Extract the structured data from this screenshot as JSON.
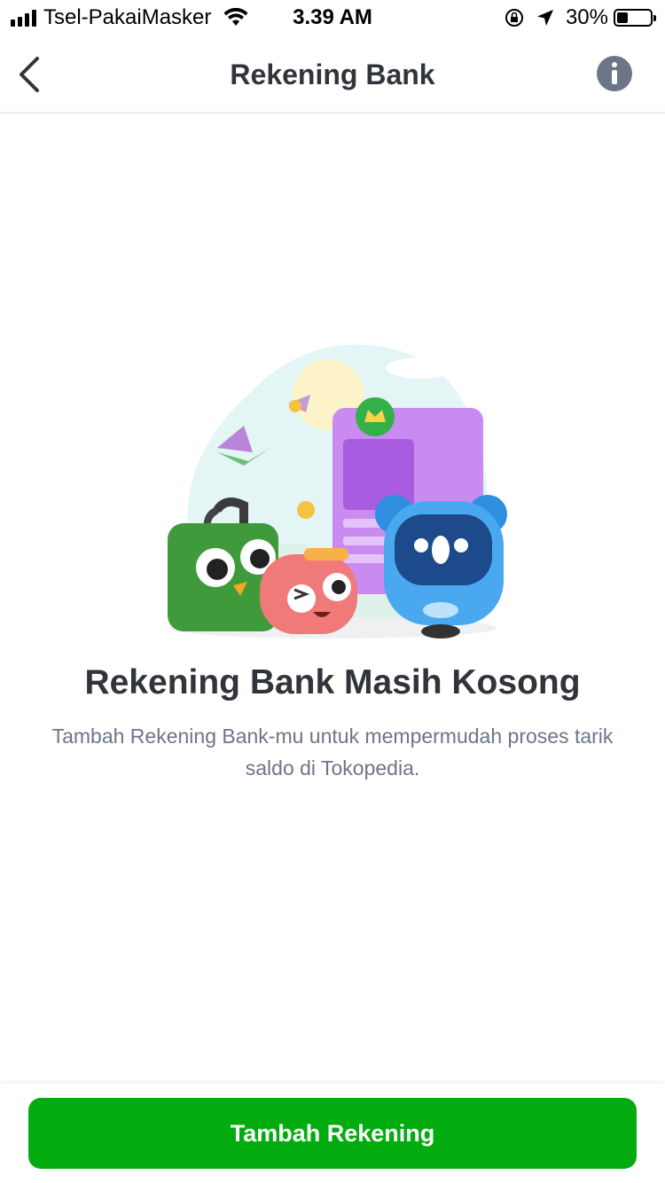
{
  "status_bar": {
    "carrier": "Tsel-PakaiMasker",
    "time": "3.39 AM",
    "battery": "30%"
  },
  "header": {
    "title": "Rekening Bank"
  },
  "empty_state": {
    "title": "Rekening Bank Masih Kosong",
    "description": "Tambah Rekening Bank-mu untuk mempermudah proses tarik saldo di Tokopedia."
  },
  "footer": {
    "button_label": "Tambah Rekening"
  },
  "colors": {
    "primary_green": "#03ac0e",
    "text_dark": "#31353b",
    "text_muted": "#6d7588"
  },
  "icons": [
    "back-arrow-icon",
    "info-icon",
    "wifi-icon",
    "signal-icon",
    "battery-icon",
    "location-icon",
    "rotation-lock-icon"
  ]
}
